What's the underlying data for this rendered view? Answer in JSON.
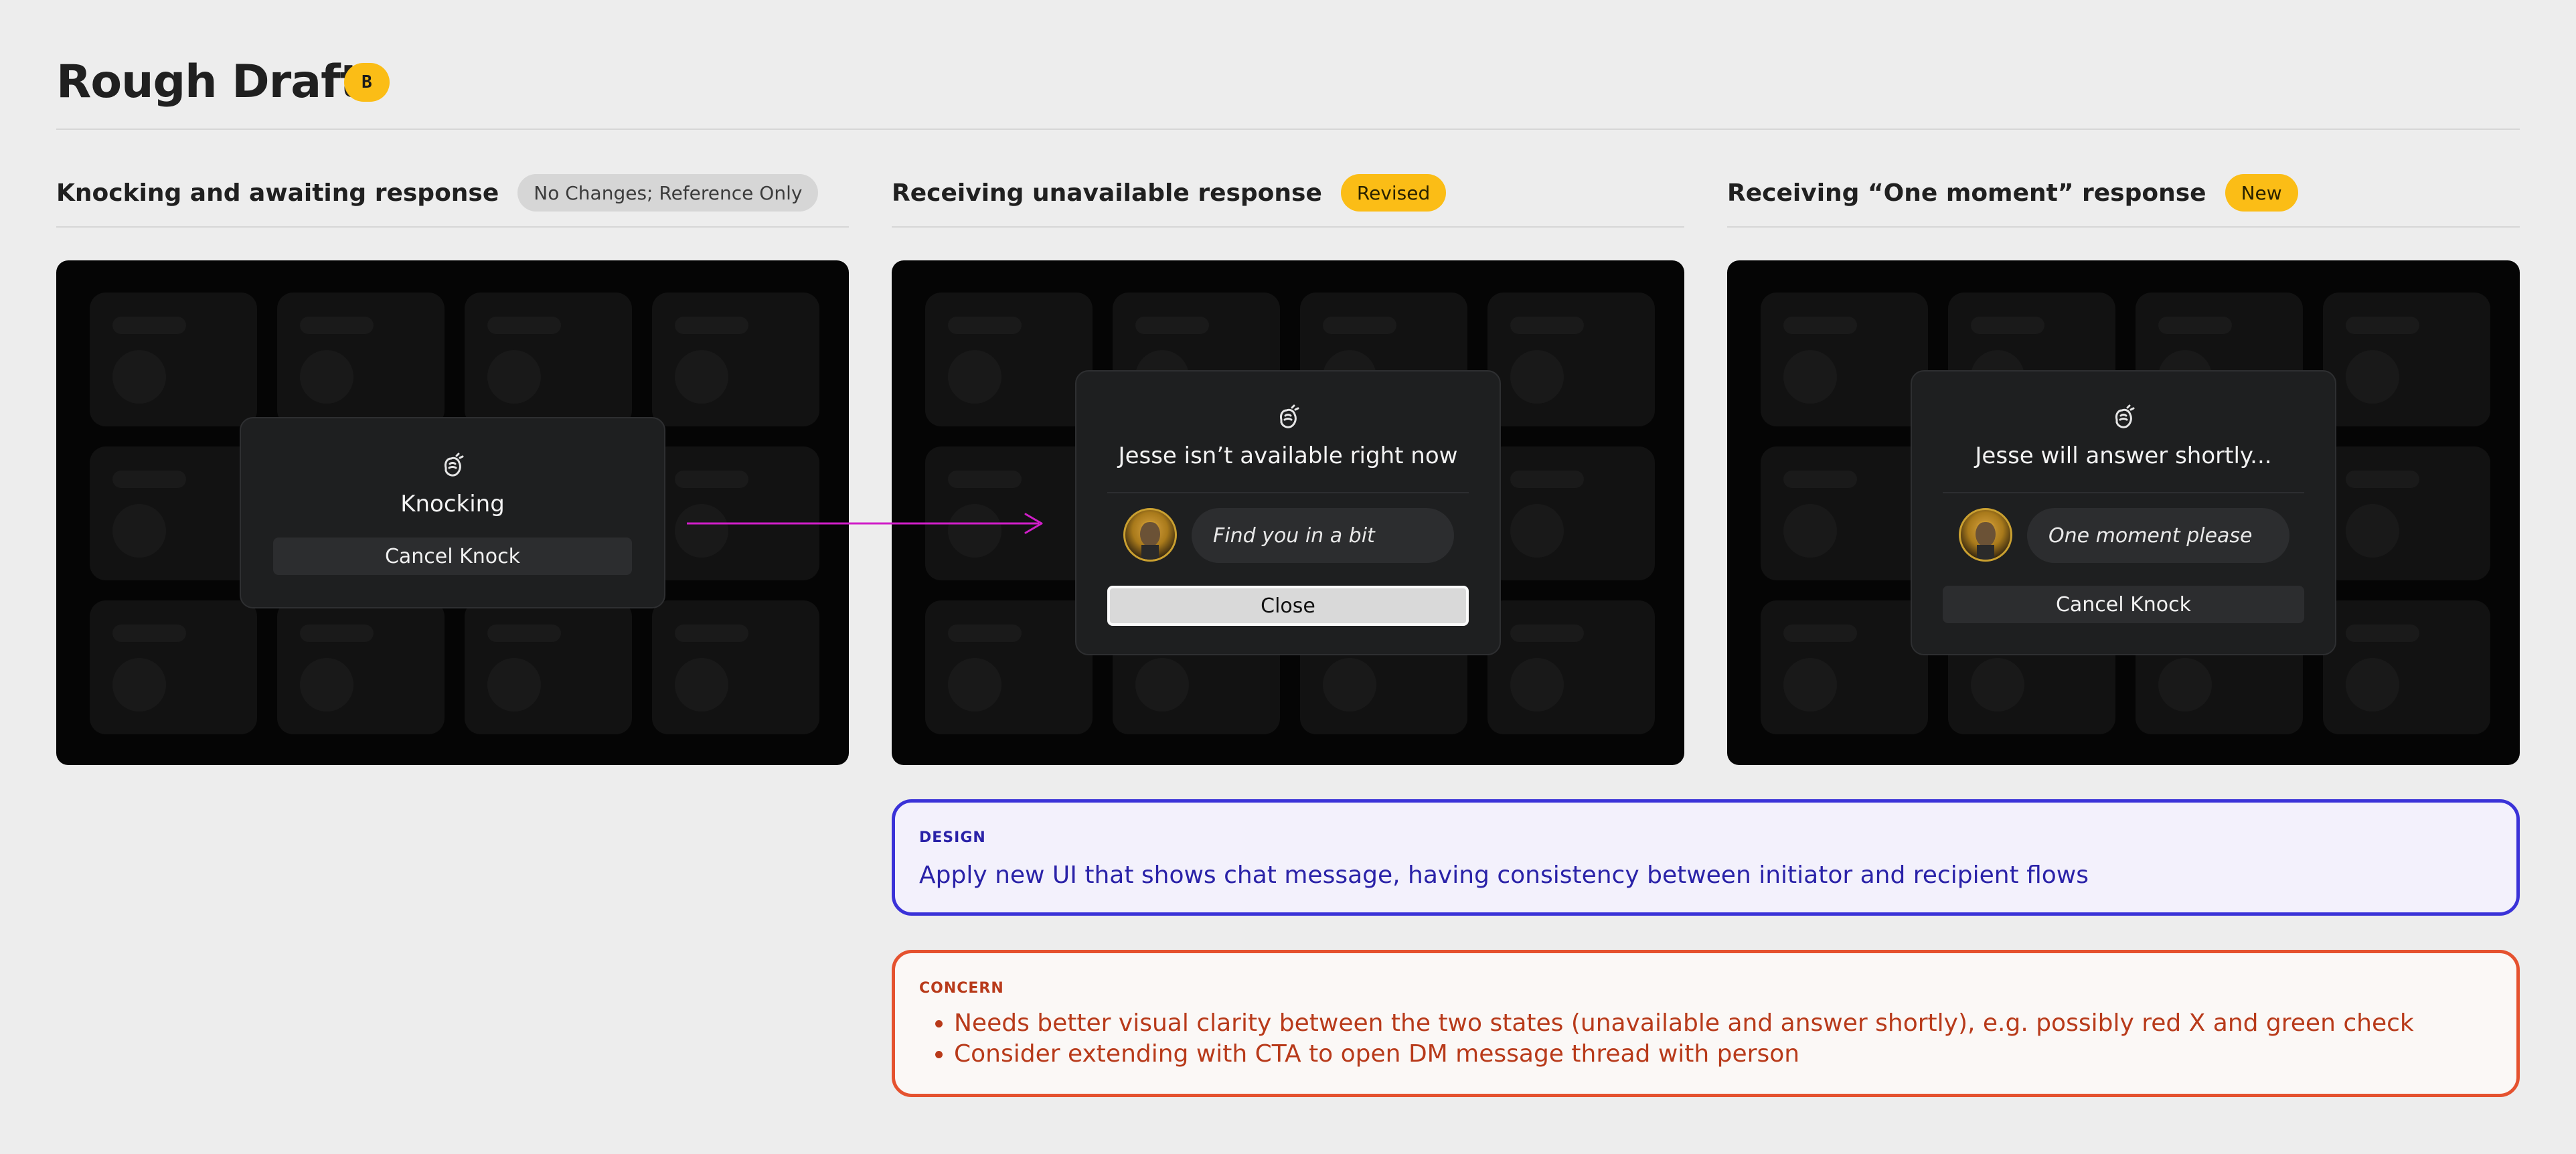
{
  "page": {
    "title": "Rough Draft",
    "badge": "B"
  },
  "columns": [
    {
      "title": "Knocking and awaiting response",
      "status": "No Changes; Reference Only"
    },
    {
      "title": "Receiving unavailable response",
      "status": "Revised"
    },
    {
      "title": "Receiving “One moment” response",
      "status": "New"
    }
  ],
  "screens": {
    "knocking": {
      "icon": "knock-hand-icon",
      "title": "Knocking",
      "button": "Cancel Knock"
    },
    "unavailable": {
      "icon": "knock-hand-icon",
      "title": "Jesse isn’t available right now",
      "message": "Find you in a bit",
      "button": "Close"
    },
    "one_moment": {
      "icon": "knock-hand-icon",
      "title": "Jesse will answer shortly...",
      "message": "One moment please",
      "button": "Cancel Knock"
    }
  },
  "notes": {
    "design": {
      "tag": "DESIGN",
      "text": "Apply new UI that shows chat message, having consistency between initiator and recipient flows"
    },
    "concern": {
      "tag": "CONCERN",
      "items": [
        "Needs better visual clarity between the two states (unavailable and answer shortly), e.g. possibly red X and green check",
        "Consider extending with CTA to open DM message thread with person"
      ]
    }
  },
  "colors": {
    "accent_yellow": "#fbbd16",
    "design_blue": "#3a32d8",
    "concern_orange": "#e5522f",
    "arrow_magenta": "#d01ec8"
  }
}
